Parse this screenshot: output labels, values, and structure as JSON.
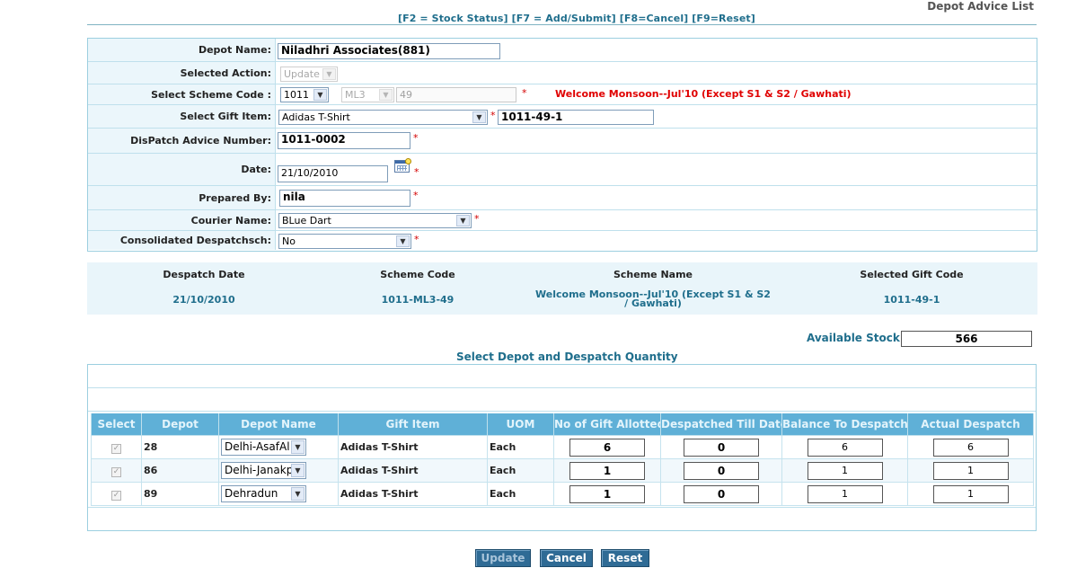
{
  "page_title": "Depot Advice List",
  "shortcuts": "[F2 = Stock Status] [F7 = Add/Submit] [F8=Cancel] [F9=Reset]",
  "form": {
    "depot_name": {
      "label": "Depot Name:",
      "value": "Niladhri Associates(881)"
    },
    "selected_action": {
      "label": "Selected Action:",
      "value": "Update"
    },
    "scheme_code": {
      "label": "Select Scheme Code :",
      "code": "1011",
      "sub": "ML3",
      "number": "49",
      "scheme_text": "Welcome Monsoon--Jul'10 (Except S1 & S2 / Gawhati)"
    },
    "gift_item": {
      "label": "Select Gift Item:",
      "value": "Adidas T-Shirt",
      "code": "1011-49-1"
    },
    "dispatch_advice_number": {
      "label": "DisPatch Advice Number:",
      "value": "1011-0002"
    },
    "date": {
      "label": "Date:",
      "value": "21/10/2010"
    },
    "prepared_by": {
      "label": "Prepared By:",
      "value": "nila"
    },
    "courier_name": {
      "label": "Courier Name:",
      "value": "BLue Dart"
    },
    "consolidated": {
      "label": "Consolidated Despatchsch:",
      "value": "No"
    },
    "required_mark": "*"
  },
  "summary": {
    "headers": [
      "Despatch Date",
      "Scheme Code",
      "Scheme Name",
      "Selected Gift Code"
    ],
    "values": [
      "21/10/2010",
      "1011-ML3-49",
      "Welcome Monsoon--Jul'10 (Except S1 & S2 / Gawhati)",
      "1011-49-1"
    ]
  },
  "available_stock": {
    "label": "Available Stock",
    "value": "566"
  },
  "section_title": "Select Depot and Despatch Quantity",
  "grid": {
    "columns": [
      "Select",
      "Depot",
      "Depot Name",
      "Gift Item",
      "UOM",
      "No of Gift Allotted",
      "Despatched Till Date",
      "Balance To Despatch",
      "Actual Despatch"
    ],
    "rows": [
      {
        "depot": "28",
        "depot_name": "Delhi-AsafAl",
        "gift_item": "Adidas T-Shirt",
        "uom": "Each",
        "allotted": "6",
        "despatched": "0",
        "balance": "6",
        "actual": "6"
      },
      {
        "depot": "86",
        "depot_name": "Delhi-Janakp",
        "gift_item": "Adidas T-Shirt",
        "uom": "Each",
        "allotted": "1",
        "despatched": "0",
        "balance": "1",
        "actual": "1"
      },
      {
        "depot": "89",
        "depot_name": "Dehradun",
        "gift_item": "Adidas T-Shirt",
        "uom": "Each",
        "allotted": "1",
        "despatched": "0",
        "balance": "1",
        "actual": "1"
      }
    ]
  },
  "buttons": {
    "update": "Update",
    "cancel": "Cancel",
    "reset": "Reset"
  },
  "colors": {
    "accent": "#1f6e8c",
    "header_bg": "#5fb0d7",
    "required": "#d40000",
    "button": "#2f6b95"
  }
}
